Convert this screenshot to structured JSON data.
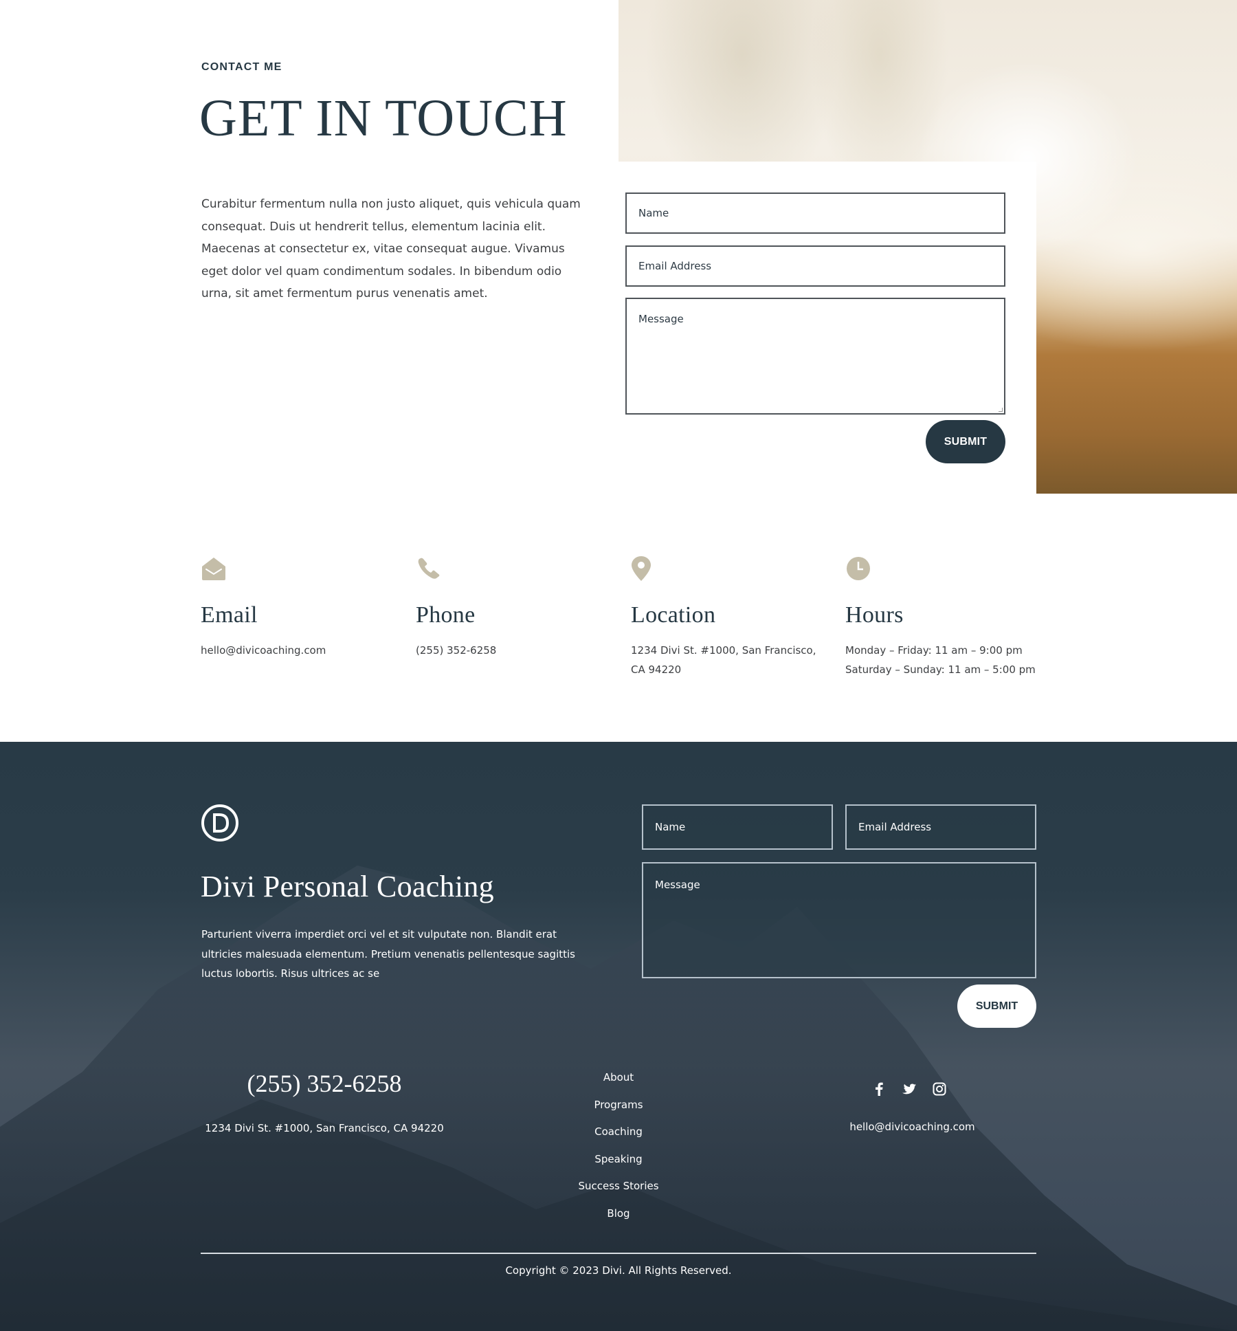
{
  "contact": {
    "eyebrow": "CONTACT ME",
    "title": "GET IN TOUCH",
    "intro": "Curabitur fermentum nulla non justo aliquet, quis vehicula quam consequat. Duis ut hendrerit tellus, elementum lacinia elit. Maecenas at consectetur ex, vitae consequat augue. Vivamus eget dolor vel quam condimentum sodales. In bibendum odio urna, sit amet fermentum purus venenatis amet.",
    "form": {
      "name_placeholder": "Name",
      "email_placeholder": "Email Address",
      "message_placeholder": "Message",
      "name_value": "",
      "email_value": "",
      "message_value": "",
      "submit_label": "SUBMIT"
    }
  },
  "info": [
    {
      "icon": "envelope-open-icon",
      "title": "Email",
      "lines": [
        "hello@divicoaching.com"
      ]
    },
    {
      "icon": "phone-icon",
      "title": "Phone",
      "lines": [
        "(255) 352-6258"
      ]
    },
    {
      "icon": "map-pin-icon",
      "title": "Location",
      "lines": [
        "1234 Divi St. #1000, San Francisco,",
        "CA 94220"
      ]
    },
    {
      "icon": "clock-icon",
      "title": "Hours",
      "lines": [
        "Monday – Friday: 11 am – 9:00 pm",
        "Saturday – Sunday: 11 am – 5:00 pm"
      ]
    }
  ],
  "footer": {
    "logo_letter": "D",
    "brand": "Divi Personal Coaching",
    "about": "Parturient viverra imperdiet orci vel et sit vulputate non. Blandit erat ultricies malesuada elementum. Pretium venenatis pellentesque sagittis luctus lobortis. Risus ultrices ac se",
    "form": {
      "name_placeholder": "Name",
      "email_placeholder": "Email Address",
      "message_placeholder": "Message",
      "submit_label": "SUBMIT"
    },
    "phone": "(255) 352-6258",
    "address": "1234 Divi St. #1000, San Francisco, CA 94220",
    "menu": [
      "About",
      "Programs",
      "Coaching",
      "Speaking",
      "Success Stories",
      "Blog"
    ],
    "social": [
      "facebook-icon",
      "twitter-icon",
      "instagram-icon"
    ],
    "email": "hello@divicoaching.com",
    "copyright": "Copyright © 2023 Divi. All Rights Reserved."
  },
  "colors": {
    "primary": "#263843",
    "icon_accent": "#c4bda8",
    "footer_bg": "#283a46"
  }
}
